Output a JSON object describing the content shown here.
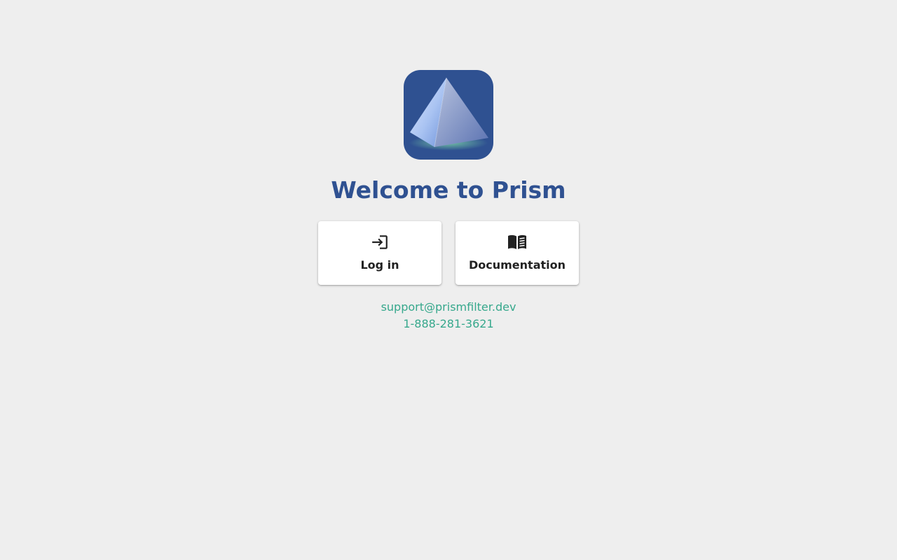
{
  "header": {
    "logo_icon": "prism-pyramid-logo",
    "title": "Welcome to Prism"
  },
  "actions": [
    {
      "label": "Log in",
      "icon": "login-icon"
    },
    {
      "label": "Documentation",
      "icon": "book-icon"
    }
  ],
  "contact": {
    "email": "support@prismfilter.dev",
    "phone": "1-888-281-3621"
  },
  "colors": {
    "background": "#eeeeee",
    "brand": "#2f5191",
    "link": "#36a88c",
    "card": "#ffffff",
    "card_text": "#222222"
  }
}
